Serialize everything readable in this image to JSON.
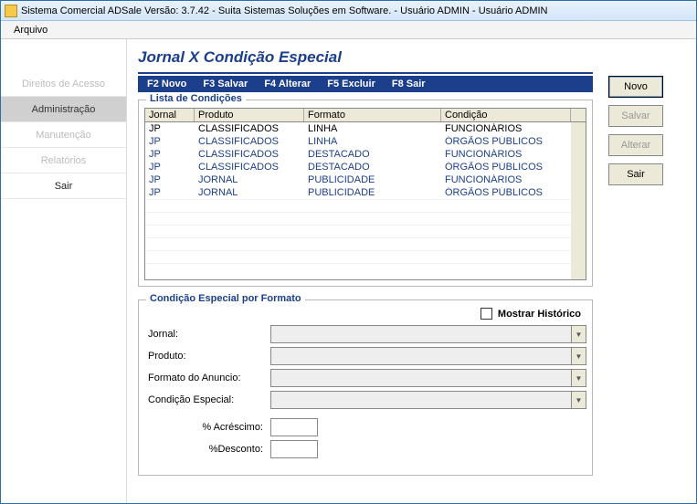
{
  "window": {
    "title": "Sistema Comercial ADSale Versão: 3.7.42 - Suita Sistemas Soluções em Software. - Usuário ADMIN - Usuário ADMIN"
  },
  "menubar": {
    "arquivo": "Arquivo"
  },
  "sidebar": {
    "items": [
      {
        "label": "Direitos de Acesso"
      },
      {
        "label": "Administração"
      },
      {
        "label": "Manutenção"
      },
      {
        "label": "Relatórios"
      },
      {
        "label": "Sair"
      }
    ]
  },
  "page": {
    "title": "Jornal X Condição Especial"
  },
  "shortcuts": {
    "novo": "F2 Novo",
    "salvar": "F3 Salvar",
    "alterar": "F4 Alterar",
    "excluir": "F5 Excluir",
    "sair": "F8 Sair"
  },
  "lista": {
    "legend": "Lista de Condições",
    "headers": {
      "jornal": "Jornal",
      "produto": "Produto",
      "formato": "Formato",
      "condicao": "Condição"
    },
    "rows": [
      {
        "jornal": "JP",
        "produto": "CLASSIFICADOS",
        "formato": "LINHA",
        "condicao": "FUNCIONÁRIOS"
      },
      {
        "jornal": "JP",
        "produto": "CLASSIFICADOS",
        "formato": "LINHA",
        "condicao": "ÓRGÃOS PÚBLICOS"
      },
      {
        "jornal": "JP",
        "produto": "CLASSIFICADOS",
        "formato": "DESTACADO",
        "condicao": "FUNCIONÁRIOS"
      },
      {
        "jornal": "JP",
        "produto": "CLASSIFICADOS",
        "formato": "DESTACADO",
        "condicao": "ÓRGÃOS PÚBLICOS"
      },
      {
        "jornal": "JP",
        "produto": "JORNAL",
        "formato": "PUBLICIDADE",
        "condicao": "FUNCIONÁRIOS"
      },
      {
        "jornal": "JP",
        "produto": "JORNAL",
        "formato": "PUBLICIDADE",
        "condicao": "ÓRGÃOS PÚBLICOS"
      }
    ]
  },
  "form": {
    "legend": "Condição Especial por Formato",
    "mostrar_historico": "Mostrar Histórico",
    "labels": {
      "jornal": "Jornal:",
      "produto": "Produto:",
      "formato": "Formato do Anuncio:",
      "condicao": "Condição Especial:",
      "acrescimo": "% Acréscimo:",
      "desconto": "%Desconto:"
    },
    "values": {
      "jornal": "",
      "produto": "",
      "formato": "",
      "condicao": "",
      "acrescimo": "",
      "desconto": ""
    }
  },
  "buttons": {
    "novo": "Novo",
    "salvar": "Salvar",
    "alterar": "Alterar",
    "sair": "Sair"
  }
}
